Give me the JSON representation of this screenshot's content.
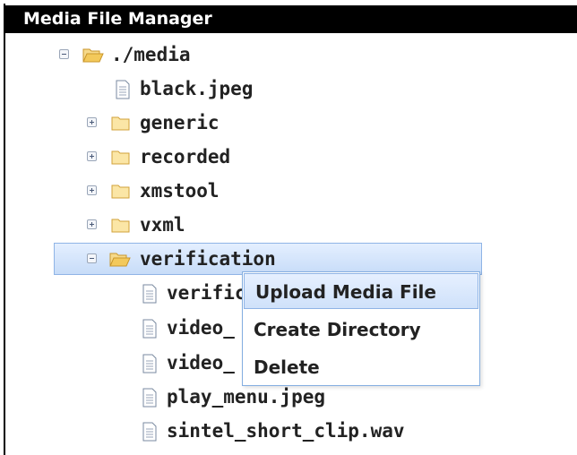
{
  "app": {
    "title": "Media File Manager"
  },
  "tree": {
    "root_label": "./media",
    "items": [
      {
        "label": "black.jpeg"
      },
      {
        "label": "generic"
      },
      {
        "label": "recorded"
      },
      {
        "label": "xmstool"
      },
      {
        "label": "vxml"
      },
      {
        "label": "verification"
      },
      {
        "label": "verifica"
      },
      {
        "label": "video_"
      },
      {
        "label": "video_"
      },
      {
        "label": "play_menu.jpeg"
      },
      {
        "label": "sintel_short_clip.wav"
      }
    ]
  },
  "context_menu": {
    "items": [
      {
        "label": "Upload Media File"
      },
      {
        "label": "Create Directory"
      },
      {
        "label": "Delete"
      }
    ]
  },
  "colors": {
    "titlebar": "#000000",
    "selection": "#c7dcf8",
    "selection_border": "#8fb4e6",
    "folder": "#e8b93a"
  }
}
